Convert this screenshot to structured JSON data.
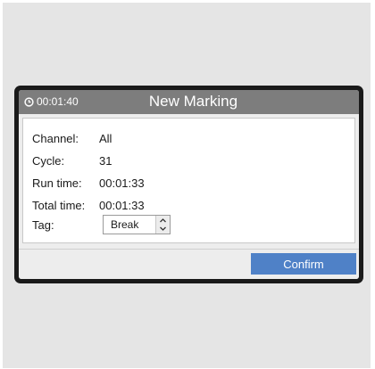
{
  "header": {
    "timer": "00:01:40",
    "title": "New Marking"
  },
  "fields": {
    "channel_label": "Channel:",
    "channel_value": "All",
    "cycle_label": "Cycle:",
    "cycle_value": "31",
    "run_time_label": "Run time:",
    "run_time_value": "00:01:33",
    "total_time_label": "Total time:",
    "total_time_value": "00:01:33",
    "tag_label": "Tag:",
    "tag_value": "Break"
  },
  "footer": {
    "confirm_label": "Confirm"
  },
  "colors": {
    "titlebar": "#7d7d7d",
    "confirm": "#4f81c7",
    "frame": "#1a1a1a"
  },
  "icons": {
    "timer": "clock-icon",
    "spinner_up": "chevron-up-icon",
    "spinner_down": "chevron-down-icon"
  }
}
